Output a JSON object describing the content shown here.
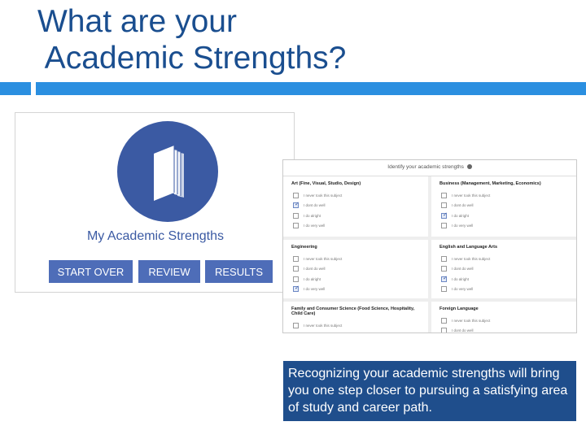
{
  "slide": {
    "title": "What are your\n Academic Strengths?",
    "caption": "Recognizing your academic strengths will bring you one step closer to pursuing a satisfying area of study and career path."
  },
  "app_card": {
    "icon": "book-icon",
    "title": "My Academic Strengths",
    "buttons": [
      "START OVER",
      "REVIEW",
      "RESULTS"
    ]
  },
  "form": {
    "header": "Identify your academic strengths",
    "header_icon": "info-icon",
    "categories": [
      {
        "title": "Art (Fine, Visual, Studio, Design)",
        "options": [
          {
            "label": "I never took this subject",
            "checked": false
          },
          {
            "label": "I dont do well",
            "checked": true
          },
          {
            "label": "I do alright",
            "checked": false
          },
          {
            "label": "I do very well",
            "checked": false
          }
        ]
      },
      {
        "title": "Business (Management, Marketing, Economics)",
        "options": [
          {
            "label": "I never took this subject",
            "checked": false
          },
          {
            "label": "I dont do well",
            "checked": false
          },
          {
            "label": "I do alright",
            "checked": true
          },
          {
            "label": "I do very well",
            "checked": false
          }
        ]
      },
      {
        "title": "Engineering",
        "options": [
          {
            "label": "I never took this subject",
            "checked": false
          },
          {
            "label": "I dont do well",
            "checked": false
          },
          {
            "label": "I do alright",
            "checked": false
          },
          {
            "label": "I do very well",
            "checked": true
          }
        ]
      },
      {
        "title": "English and Language Arts",
        "options": [
          {
            "label": "I never took this subject",
            "checked": false
          },
          {
            "label": "I dont do well",
            "checked": false
          },
          {
            "label": "I do alright",
            "checked": true
          },
          {
            "label": "I do very well",
            "checked": false
          }
        ]
      },
      {
        "title": "Family and Consumer Science (Food Science, Hospitality, Child Care)",
        "options": [
          {
            "label": "I never took this subject",
            "checked": false
          }
        ]
      },
      {
        "title": "Foreign Language",
        "options": [
          {
            "label": "I never took this subject",
            "checked": false
          },
          {
            "label": "I dont do well",
            "checked": false
          }
        ]
      }
    ]
  },
  "colors": {
    "title": "#1a4e8f",
    "accent_bar": "#2b8fe0",
    "brand": "#3b5aa3",
    "button": "#4e6db8",
    "caption_bg": "#1f4e8c"
  }
}
